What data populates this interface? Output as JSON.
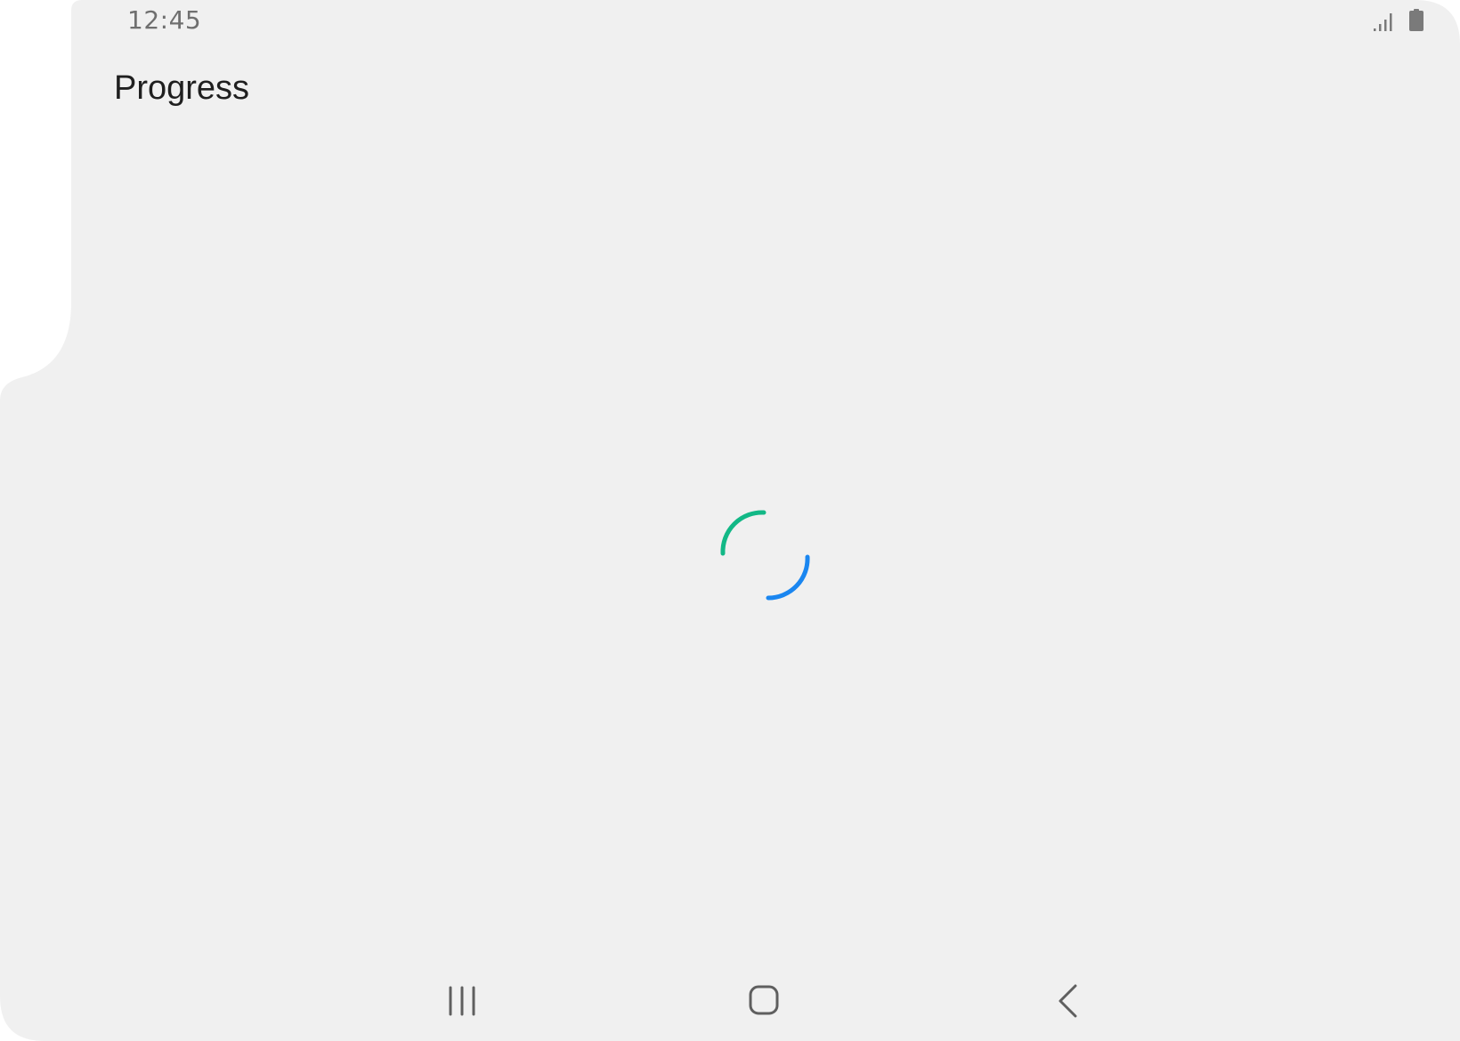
{
  "status_bar": {
    "time": "12:45",
    "icons": [
      "signal-icon",
      "battery-icon"
    ]
  },
  "app_bar": {
    "title": "Progress"
  },
  "progress": {
    "type": "indeterminate-circular",
    "colors": [
      "#12b886",
      "#1a86f0"
    ]
  },
  "navigation_bar": {
    "icons": [
      "recent-apps-icon",
      "home-icon",
      "back-icon"
    ]
  },
  "colors": {
    "surface": "#f0f0f0",
    "background": "#ffffff",
    "text_primary": "#1f1f1f",
    "text_secondary": "#6f6f6f",
    "nav_icon": "#5f5f5f"
  }
}
